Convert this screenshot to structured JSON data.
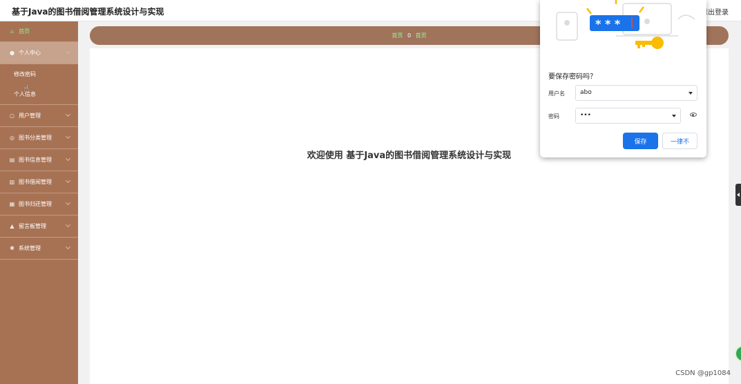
{
  "app": {
    "title": "基于Java的图书借阅管理系统设计与实现",
    "logout_label": "退出登录"
  },
  "sidebar": {
    "items": [
      {
        "label": "首页",
        "icon": "home-icon"
      },
      {
        "label": "个人中心",
        "icon": "user-icon",
        "expanded": true,
        "children": [
          {
            "label": "修改密码"
          },
          {
            "label": "个人信息"
          }
        ]
      },
      {
        "label": "用户管理",
        "icon": "users-icon"
      },
      {
        "label": "图书分类管理",
        "icon": "category-icon"
      },
      {
        "label": "图书信息管理",
        "icon": "book-icon"
      },
      {
        "label": "图书借阅管理",
        "icon": "borrow-icon"
      },
      {
        "label": "图书归还管理",
        "icon": "return-icon"
      },
      {
        "label": "留言板管理",
        "icon": "message-icon"
      },
      {
        "label": "系统管理",
        "icon": "settings-icon"
      }
    ]
  },
  "breadcrumb": {
    "items": [
      "首页",
      "首页"
    ],
    "separator": "0"
  },
  "main": {
    "welcome": "欢迎使用 基于Java的图书借阅管理系统设计与实现"
  },
  "password_dialog": {
    "question": "要保存密码吗？",
    "username_label": "用户名",
    "username_value": "abo",
    "password_label": "密码",
    "password_value": "•••",
    "save_label": "保存",
    "never_label": "一律不",
    "illustration_mask": "* * *"
  },
  "watermark": "CSDN @gp1084",
  "colors": {
    "sidebar_bg": "#a77254",
    "breadcrumb_bg": "#a0735b",
    "active_green": "#8ff28f",
    "save_blue": "#1a73e8"
  }
}
